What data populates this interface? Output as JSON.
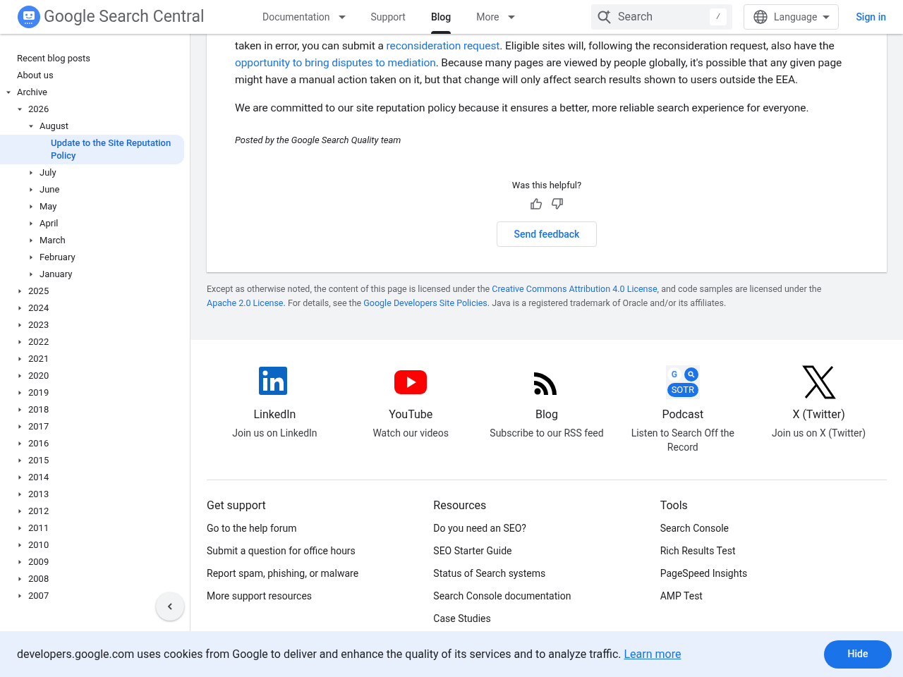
{
  "header": {
    "logo_text": "Google Search Central",
    "nav": [
      {
        "label": "Documentation",
        "dropdown": true,
        "selected": false
      },
      {
        "label": "Support",
        "dropdown": false,
        "selected": false
      },
      {
        "label": "Blog",
        "dropdown": false,
        "selected": true
      },
      {
        "label": "More",
        "dropdown": true,
        "selected": false
      }
    ],
    "search": {
      "placeholder": "Search",
      "shortcut": "/"
    },
    "language": "Language",
    "sign_in": "Sign in"
  },
  "sidebar": {
    "items": [
      {
        "label": "Recent blog posts",
        "selected": false
      },
      {
        "label": "About us",
        "selected": false
      },
      {
        "label": "Archive",
        "selected": false,
        "expanded": true,
        "children": [
          {
            "label": "2026",
            "selected": false,
            "expanded": true,
            "children": [
              {
                "label": "August",
                "selected": false,
                "expanded": true,
                "children": [
                  {
                    "label": "Update to the Site Reputation Policy",
                    "selected": true
                  }
                ]
              },
              {
                "label": "July",
                "selected": false,
                "expanded": false
              },
              {
                "label": "June",
                "selected": false,
                "expanded": false
              },
              {
                "label": "May",
                "selected": false,
                "expanded": false
              },
              {
                "label": "April",
                "selected": false,
                "expanded": false
              },
              {
                "label": "March",
                "selected": false,
                "expanded": false
              },
              {
                "label": "February",
                "selected": false,
                "expanded": false
              },
              {
                "label": "January",
                "selected": false,
                "expanded": false
              }
            ]
          },
          {
            "label": "2025",
            "selected": false,
            "expanded": false
          },
          {
            "label": "2024",
            "selected": false,
            "expanded": false
          },
          {
            "label": "2023",
            "selected": false,
            "expanded": false
          },
          {
            "label": "2022",
            "selected": false,
            "expanded": false
          },
          {
            "label": "2021",
            "selected": false,
            "expanded": false
          },
          {
            "label": "2020",
            "selected": false,
            "expanded": false
          },
          {
            "label": "2019",
            "selected": false,
            "expanded": false
          },
          {
            "label": "2018",
            "selected": false,
            "expanded": false
          },
          {
            "label": "2017",
            "selected": false,
            "expanded": false
          },
          {
            "label": "2016",
            "selected": false,
            "expanded": false
          },
          {
            "label": "2015",
            "selected": false,
            "expanded": false
          },
          {
            "label": "2014",
            "selected": false,
            "expanded": false
          },
          {
            "label": "2013",
            "selected": false,
            "expanded": false
          },
          {
            "label": "2012",
            "selected": false,
            "expanded": false
          },
          {
            "label": "2011",
            "selected": false,
            "expanded": false
          },
          {
            "label": "2010",
            "selected": false,
            "expanded": false
          },
          {
            "label": "2009",
            "selected": false,
            "expanded": false
          },
          {
            "label": "2008",
            "selected": false,
            "expanded": false
          },
          {
            "label": "2007",
            "selected": false,
            "expanded": false
          }
        ]
      }
    ]
  },
  "article": {
    "paragraphs": [
      [
        {
          "text": "taken in error, you can submit a ",
          "link": false
        },
        {
          "text": "reconsideration request",
          "link": true
        },
        {
          "text": ". Eligible sites will, following the reconsideration request, also have the ",
          "link": false
        },
        {
          "text": "opportunity to bring disputes to mediation",
          "link": true
        },
        {
          "text": ". Because many pages are viewed by people globally, it's possible that any given page might have a manual action taken on it, but that change will only affect search results shown to users outside the EEA.",
          "link": false
        }
      ],
      [
        {
          "text": "We are committed to our site reputation policy because it ensures a better, more reliable search experience for everyone.",
          "link": false
        }
      ]
    ],
    "byline": "Posted by the Google Search Quality team",
    "helpful": "Was this helpful?",
    "feedback": "Send feedback"
  },
  "license": [
    {
      "text": "Except as otherwise noted, the content of this page is licensed under the ",
      "link": false
    },
    {
      "text": "Creative Commons Attribution 4.0 License",
      "link": true
    },
    {
      "text": ", and code samples are licensed under the ",
      "link": false
    },
    {
      "text": "Apache 2.0 License",
      "link": true
    },
    {
      "text": ". For details, see the ",
      "link": false
    },
    {
      "text": "Google Developers Site Policies",
      "link": true
    },
    {
      "text": ". Java is a registered trademark of Oracle and/or its affiliates.",
      "link": false
    }
  ],
  "social": [
    {
      "kind": "linkedin",
      "title": "LinkedIn",
      "description": "Join us on LinkedIn"
    },
    {
      "kind": "youtube",
      "title": "YouTube",
      "description": "Watch our videos"
    },
    {
      "kind": "rss",
      "title": "Blog",
      "description": "Subscribe to our RSS feed"
    },
    {
      "kind": "podcast",
      "title": "Podcast",
      "description": "Listen to Search Off the Record",
      "logo_letter": "G",
      "badge": "SOTR"
    },
    {
      "kind": "x",
      "title": "X (Twitter)",
      "description": "Join us on X (Twitter)"
    }
  ],
  "footer_columns": [
    {
      "heading": "Get support",
      "links": [
        "Go to the help forum",
        "Submit a question for office hours",
        "Report spam, phishing, or malware",
        "More support resources"
      ]
    },
    {
      "heading": "Resources",
      "links": [
        "Do you need an SEO?",
        "SEO Starter Guide",
        "Status of Search systems",
        "Search Console documentation",
        "Case Studies"
      ]
    },
    {
      "heading": "Tools",
      "links": [
        "Search Console",
        "Rich Results Test",
        "PageSpeed Insights",
        "AMP Test"
      ]
    }
  ],
  "cookie_bar": {
    "message": "developers.google.com uses cookies from Google to deliver and enhance the quality of its services and to analyze traffic.",
    "link": "Learn more",
    "button": "Hide"
  }
}
